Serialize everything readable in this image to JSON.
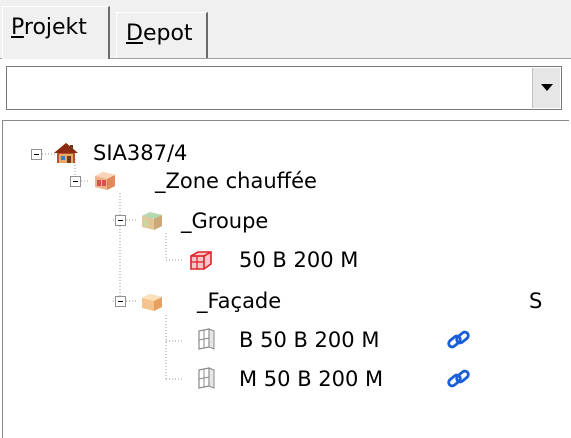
{
  "tabs": {
    "projekt": {
      "label": "Projekt",
      "underline": "P",
      "rest": "rojekt",
      "selected": true
    },
    "depot": {
      "label": "Depot",
      "underline": "D",
      "rest": "epot",
      "selected": false
    }
  },
  "combo": {
    "value": "",
    "arrow_icon": "chevron-down-icon"
  },
  "tree": {
    "nodes": [
      {
        "label": "SIA387/4",
        "icon": "house-icon",
        "level": 0
      },
      {
        "label": "_Zone chauffée",
        "icon": "heated-zone-icon",
        "level": 1
      },
      {
        "label": "_Groupe",
        "icon": "group-icon",
        "level": 2
      },
      {
        "label": "50 B 200 M",
        "icon": "red-element-icon",
        "level": 3
      },
      {
        "label": "_Façade",
        "icon": "facade-icon",
        "level": 2,
        "status": "S"
      },
      {
        "label": "B 50 B 200 M",
        "icon": "window-icon",
        "level": 3,
        "linked": true
      },
      {
        "label": "M 50 B 200 M",
        "icon": "window-icon",
        "level": 3,
        "linked": true
      }
    ]
  },
  "colors": {
    "link_blue": "#1a5fd6",
    "element_red": "#e0202a",
    "tab_bg": "#f0f0f0"
  }
}
